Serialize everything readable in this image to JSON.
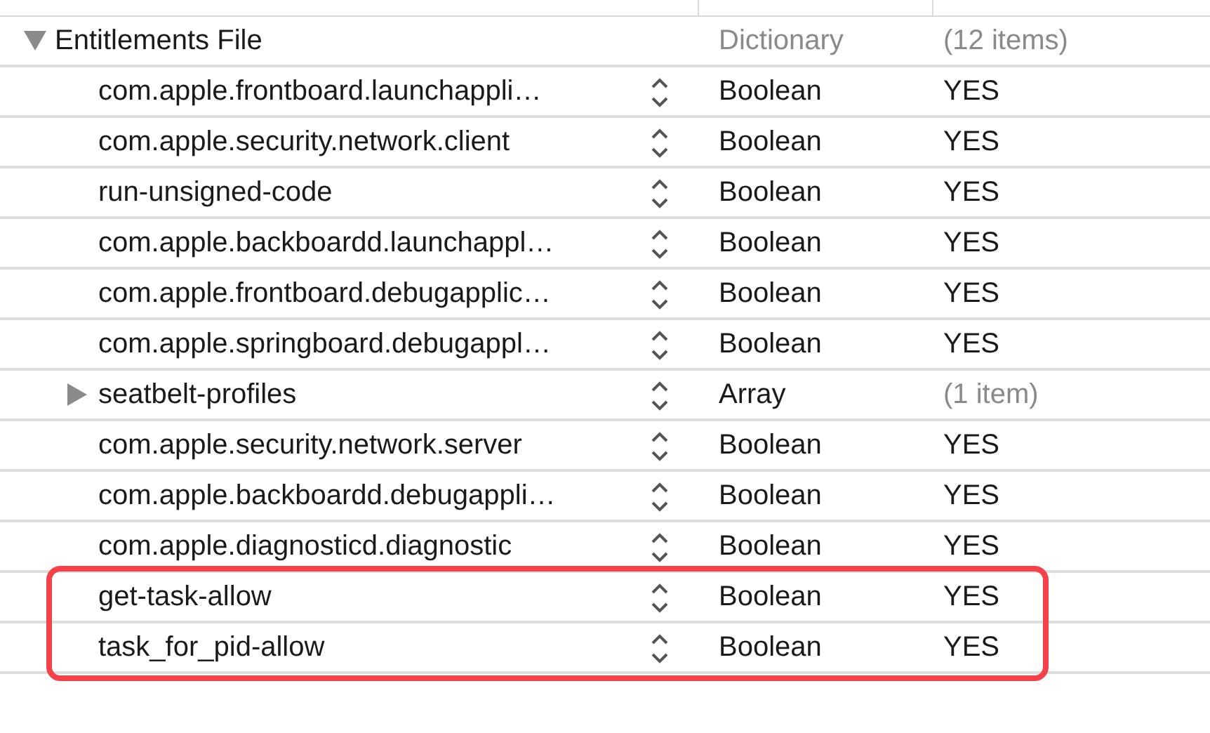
{
  "root": {
    "key": "Entitlements File",
    "type": "Dictionary",
    "value": "(12 items)",
    "kind": "group",
    "expanded": true,
    "children": [
      {
        "key": "com.apple.frontboard.launchappli…",
        "type": "Boolean",
        "value": "YES",
        "kind": "leaf",
        "highlighted": false
      },
      {
        "key": "com.apple.security.network.client",
        "type": "Boolean",
        "value": "YES",
        "kind": "leaf",
        "highlighted": false
      },
      {
        "key": "run-unsigned-code",
        "type": "Boolean",
        "value": "YES",
        "kind": "leaf",
        "highlighted": false
      },
      {
        "key": "com.apple.backboardd.launchappl…",
        "type": "Boolean",
        "value": "YES",
        "kind": "leaf",
        "highlighted": false
      },
      {
        "key": "com.apple.frontboard.debugapplic…",
        "type": "Boolean",
        "value": "YES",
        "kind": "leaf",
        "highlighted": false
      },
      {
        "key": "com.apple.springboard.debugappl…",
        "type": "Boolean",
        "value": "YES",
        "kind": "leaf",
        "highlighted": false
      },
      {
        "key": "seatbelt-profiles",
        "type": "Array",
        "value": "(1 item)",
        "kind": "group",
        "expanded": false,
        "highlighted": false
      },
      {
        "key": "com.apple.security.network.server",
        "type": "Boolean",
        "value": "YES",
        "kind": "leaf",
        "highlighted": false
      },
      {
        "key": "com.apple.backboardd.debugappli…",
        "type": "Boolean",
        "value": "YES",
        "kind": "leaf",
        "highlighted": false
      },
      {
        "key": "com.apple.diagnosticd.diagnostic",
        "type": "Boolean",
        "value": "YES",
        "kind": "leaf",
        "highlighted": false
      },
      {
        "key": "get-task-allow",
        "type": "Boolean",
        "value": "YES",
        "kind": "leaf",
        "highlighted": true
      },
      {
        "key": "task_for_pid-allow",
        "type": "Boolean",
        "value": "YES",
        "kind": "leaf",
        "highlighted": true
      }
    ]
  }
}
